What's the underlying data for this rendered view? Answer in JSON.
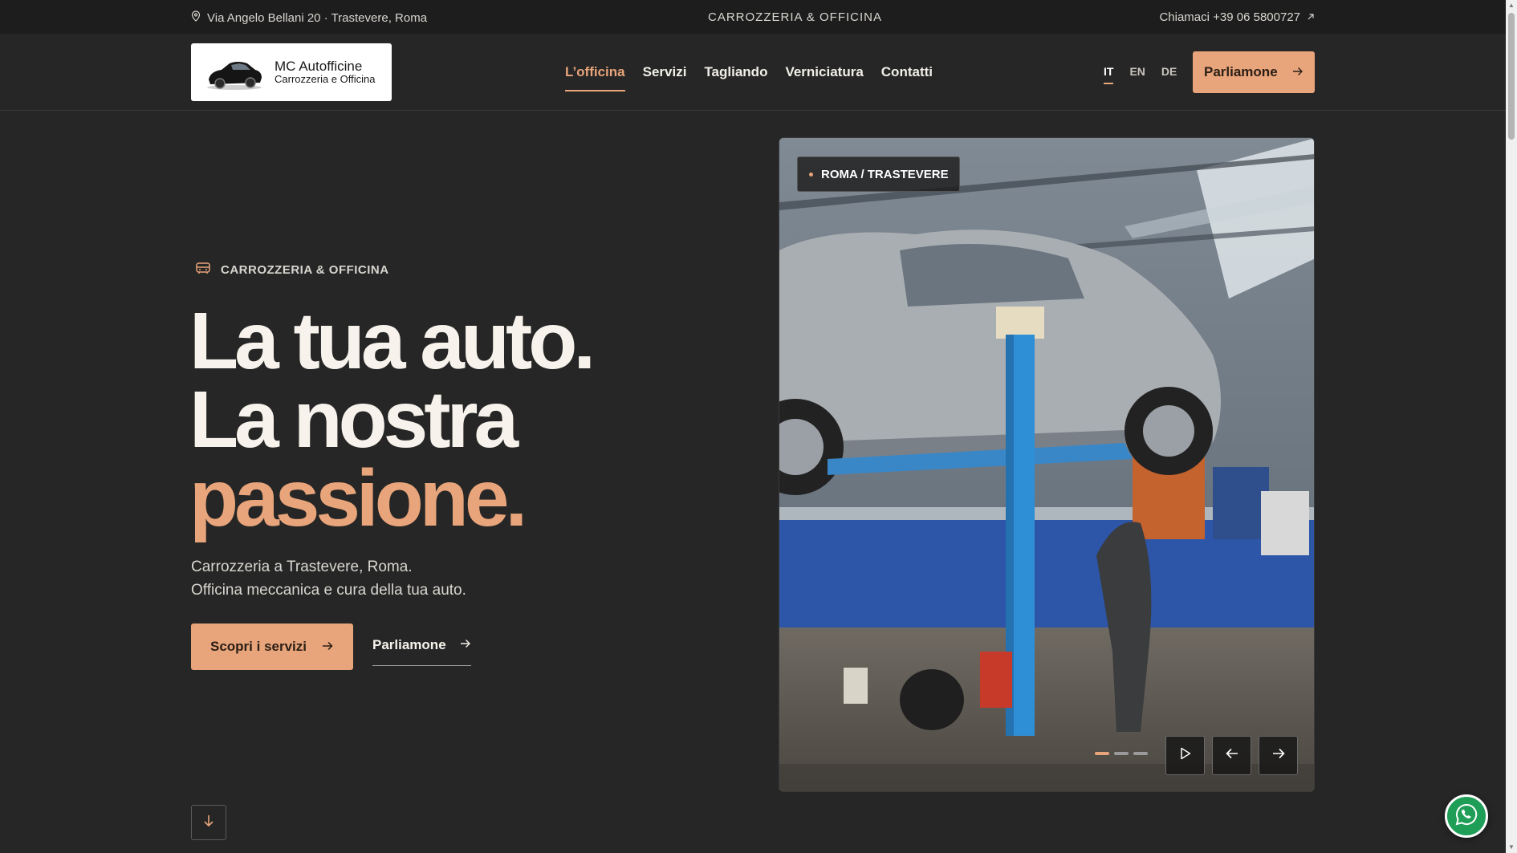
{
  "topbar": {
    "address": "Via Angelo Bellani 20 · Trastevere, Roma",
    "tagline": "CARROZZERIA & OFFICINA",
    "phone": "Chiamaci +39 06 5800727"
  },
  "logo": {
    "title": "MC Autofficine",
    "subtitle": "Carrozzeria e Officina"
  },
  "nav": {
    "items": [
      {
        "label": "L’officina",
        "active": true
      },
      {
        "label": "Servizi"
      },
      {
        "label": "Tagliando"
      },
      {
        "label": "Verniciatura"
      },
      {
        "label": "Contatti"
      }
    ],
    "languages": [
      "IT",
      "EN",
      "DE"
    ],
    "active_language": "IT",
    "cta": "Parliamone"
  },
  "hero": {
    "eyebrow": "CARROZZERIA & OFFICINA",
    "headline_line1": "La tua auto.",
    "headline_line2": "La nostra",
    "headline_line3": "passione.",
    "sub_line1": "Carrozzeria a Trastevere, Roma.",
    "sub_line2": "Officina meccanica e cura della tua auto.",
    "primary_button": "Scopri i servizi",
    "secondary_button": "Parliamone"
  },
  "gallery": {
    "badge": "ROMA / TRASTEVERE",
    "slide_count": 3,
    "active_slide": 1
  },
  "colors": {
    "accent": "#e8a47a",
    "background": "#262626",
    "topbar": "#1d1d1d",
    "whatsapp": "#1f9e57"
  },
  "icons": [
    "location-pin-icon",
    "external-arrow-icon",
    "car-icon",
    "arrow-right-icon",
    "arrow-down-icon",
    "play-icon",
    "arrow-left-icon",
    "whatsapp-icon"
  ]
}
